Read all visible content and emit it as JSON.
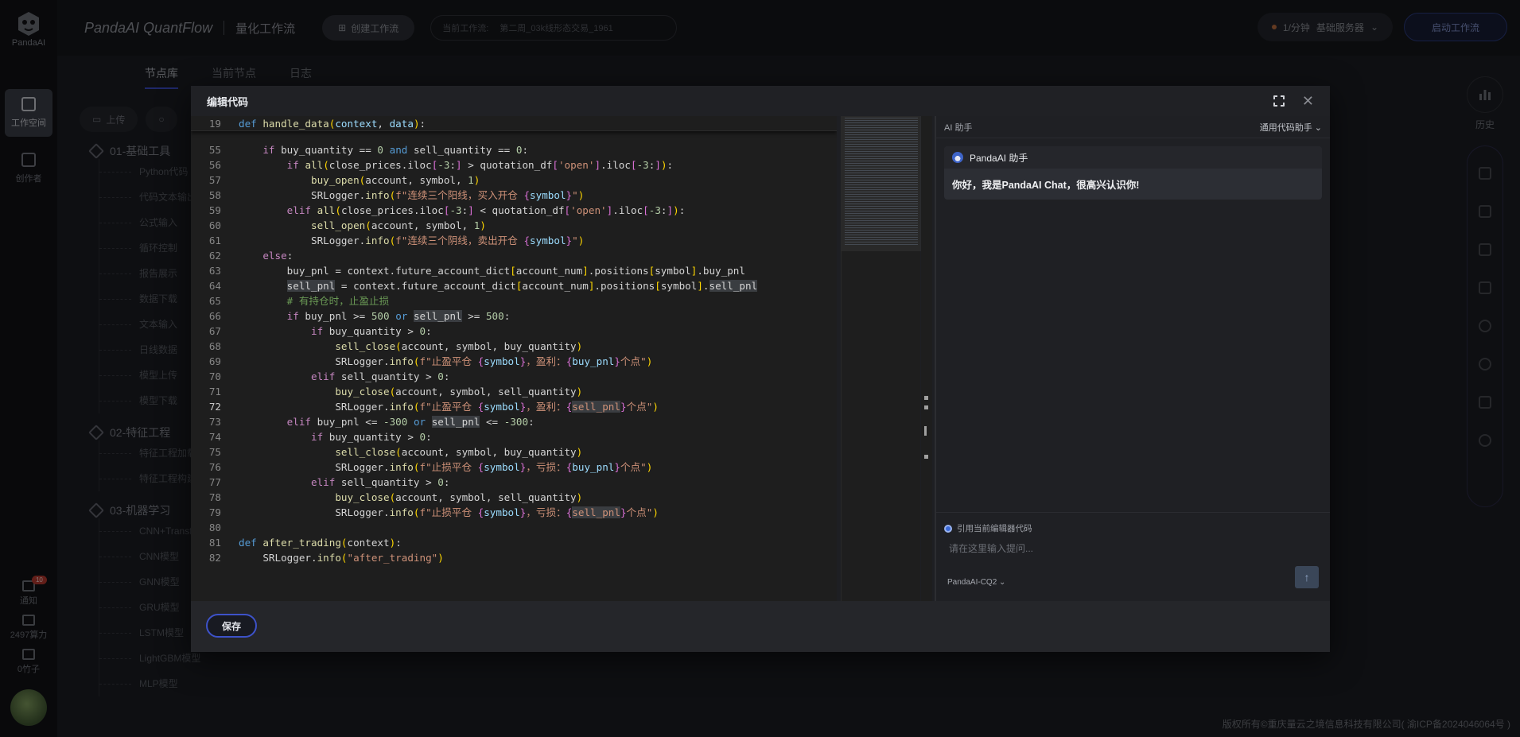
{
  "app": {
    "logo_text": "PandaAI",
    "brand": "PandaAI QuantFlow",
    "brand_sub": "量化工作流",
    "create_button": "创建工作流",
    "current_workflow_label": "当前工作流:",
    "current_workflow_value": "第二周_03k线形态交易_1961",
    "server_rate": "1/分钟",
    "server_name": "基础服务器",
    "start_button": "启动工作流",
    "copyright": "版权所有©重庆量云之境信息科技有限公司( 渝ICP备2024046064号 )"
  },
  "rail": {
    "workspace": "工作空间",
    "creator": "创作者",
    "notify": "通知",
    "notify_count": "10",
    "compute": "2497算力",
    "bamboo": "0竹子"
  },
  "tabs": [
    "节点库",
    "当前节点",
    "日志"
  ],
  "library": {
    "upload_button": "上传",
    "categories": [
      {
        "name": "01-基础工具",
        "nodes": [
          "Python代码",
          "代码文本输出",
          "公式输入",
          "循环控制",
          "报告展示",
          "数据下载",
          "文本输入",
          "日线数据",
          "模型上传",
          "模型下载"
        ]
      },
      {
        "name": "02-特征工程",
        "nodes": [
          "特征工程加载",
          "特征工程构建"
        ]
      },
      {
        "name": "03-机器学习",
        "nodes": [
          "CNN+Transformer",
          "CNN模型",
          "GNN模型",
          "GRU模型",
          "LSTM模型",
          "LightGBM模型",
          "MLP模型"
        ]
      }
    ]
  },
  "right_rail": {
    "history": "历史"
  },
  "modal": {
    "title": "编辑代码",
    "save_button": "保存",
    "ai": {
      "header": "AI 助手",
      "mode": "通用代码助手",
      "bot_name": "PandaAI 助手",
      "greeting": "你好，我是PandaAI Chat，很高兴认识你!",
      "reference_label": "引用当前编辑器代码",
      "input_placeholder": "请在这里输入提问...",
      "model": "PandaAI-CQ2"
    }
  },
  "code": {
    "sticky": {
      "n": "19",
      "text": "def handle_data(context, data):"
    },
    "current_line": "72",
    "lines": [
      {
        "n": "55",
        "text": "    if buy_quantity == 0 and sell_quantity == 0:"
      },
      {
        "n": "56",
        "text": "        if all(close_prices.iloc[-3:] > quotation_df['open'].iloc[-3:]):"
      },
      {
        "n": "57",
        "text": "            buy_open(account, symbol, 1)"
      },
      {
        "n": "58",
        "text": "            SRLogger.info(f\"连续三个阳线，买入开仓 {symbol}\")"
      },
      {
        "n": "59",
        "text": "        elif all(close_prices.iloc[-3:] < quotation_df['open'].iloc[-3:]):"
      },
      {
        "n": "60",
        "text": "            sell_open(account, symbol, 1)"
      },
      {
        "n": "61",
        "text": "            SRLogger.info(f\"连续三个阴线，卖出开仓 {symbol}\")"
      },
      {
        "n": "62",
        "text": "    else:"
      },
      {
        "n": "63",
        "text": "        buy_pnl = context.future_account_dict[account_num].positions[symbol].buy_pnl"
      },
      {
        "n": "64",
        "text": "        sell_pnl = context.future_account_dict[account_num].positions[symbol].sell_pnl"
      },
      {
        "n": "65",
        "text": "        # 有持仓时，止盈止损"
      },
      {
        "n": "66",
        "text": "        if buy_pnl >= 500 or sell_pnl >= 500:"
      },
      {
        "n": "67",
        "text": "            if buy_quantity > 0:"
      },
      {
        "n": "68",
        "text": "                sell_close(account, symbol, buy_quantity)"
      },
      {
        "n": "69",
        "text": "                SRLogger.info(f\"止盈平仓 {symbol}，盈利：{buy_pnl}个点\")"
      },
      {
        "n": "70",
        "text": "            elif sell_quantity > 0:"
      },
      {
        "n": "71",
        "text": "                buy_close(account, symbol, sell_quantity)"
      },
      {
        "n": "72",
        "text": "                SRLogger.info(f\"止盈平仓 {symbol}，盈利：{sell_pnl}个点\")"
      },
      {
        "n": "73",
        "text": "        elif buy_pnl <= -300 or sell_pnl <= -300:"
      },
      {
        "n": "74",
        "text": "            if buy_quantity > 0:"
      },
      {
        "n": "75",
        "text": "                sell_close(account, symbol, buy_quantity)"
      },
      {
        "n": "76",
        "text": "                SRLogger.info(f\"止损平仓 {symbol}，亏损：{buy_pnl}个点\")"
      },
      {
        "n": "77",
        "text": "            elif sell_quantity > 0:"
      },
      {
        "n": "78",
        "text": "                buy_close(account, symbol, sell_quantity)"
      },
      {
        "n": "79",
        "text": "                SRLogger.info(f\"止损平仓 {symbol}，亏损：{sell_pnl}个点\")"
      },
      {
        "n": "80",
        "text": ""
      },
      {
        "n": "81",
        "text": "def after_trading(context):"
      },
      {
        "n": "82",
        "text": "    SRLogger.info(\"after_trading\")"
      }
    ]
  },
  "colors": {
    "accent": "#3d52c9",
    "keyword": "#569cd6",
    "control": "#c586c0",
    "function": "#dcdcaa",
    "string": "#ce9178",
    "number": "#b5cea8",
    "comment": "#6a9955"
  }
}
